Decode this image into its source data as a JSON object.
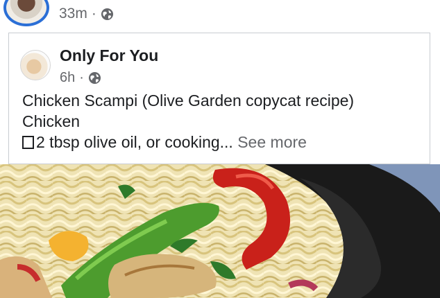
{
  "top_post": {
    "time": "33m",
    "separator": "·",
    "privacy_icon": "globe-icon"
  },
  "shared_post": {
    "author": "Only For You",
    "time": "6h",
    "separator": "·",
    "privacy_icon": "globe-icon",
    "text_line1": "Chicken Scampi (Olive Garden copycat recipe)",
    "text_line2": "Chicken",
    "text_line3_prefix_icon": "empty-checkbox-icon",
    "text_line3": "2 tbsp olive oil, or cooking...",
    "see_more": "See more"
  },
  "photo": {
    "subject": "food-photo",
    "accent": "#2b6fd6"
  }
}
